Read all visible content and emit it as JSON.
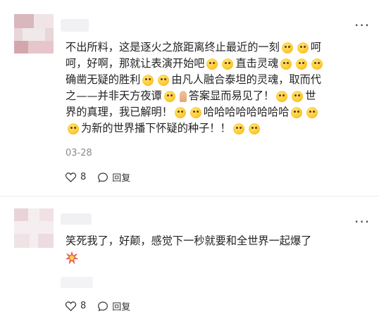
{
  "comments": [
    {
      "body_lines": [
        [
          {
            "t": "不出所料，这是逐火之旅距离终止最近的一刻"
          },
          {
            "e": "face-icon"
          },
          {
            "e": "face-icon"
          },
          {
            "t": "呵"
          }
        ],
        [
          {
            "t": "呵，好啊，那就让表演开始吧"
          },
          {
            "e": "face-icon"
          },
          {
            "e": "face-icon"
          },
          {
            "t": "直击灵魂"
          },
          {
            "e": "face-icon"
          },
          {
            "e": "face-icon"
          },
          {
            "e": "face-icon"
          }
        ],
        [
          {
            "t": "确凿无疑的胜利"
          },
          {
            "e": "face-icon"
          },
          {
            "e": "face-icon"
          },
          {
            "t": "由凡人融合泰坦的灵魂，取而代"
          }
        ],
        [
          {
            "t": "之——并非天方夜谭"
          },
          {
            "e": "face-icon"
          },
          {
            "e": "pray-icon"
          },
          {
            "t": "答案显而易见了！"
          },
          {
            "e": "face-icon"
          },
          {
            "e": "face-icon"
          },
          {
            "t": "世"
          }
        ],
        [
          {
            "t": "界的真理，我已解明！"
          },
          {
            "e": "face-icon"
          },
          {
            "e": "face-icon"
          },
          {
            "t": "哈哈哈哈哈哈哈哈"
          },
          {
            "e": "face-icon"
          },
          {
            "e": "face-icon"
          }
        ],
        [
          {
            "e": "face-icon"
          },
          {
            "t": "为新的世界播下怀疑的种子！！"
          },
          {
            "e": "face-icon"
          },
          {
            "e": "face-icon"
          }
        ]
      ],
      "date": "03-28",
      "likes": "8",
      "reply_label": "回复"
    },
    {
      "body_lines": [
        [
          {
            "t": "笑死我了，好颠，感觉下一秒就要和全世界一起爆了"
          }
        ],
        [
          {
            "e": "explosion-icon"
          }
        ]
      ],
      "likes": "8",
      "reply_label": "回复"
    }
  ],
  "icons": {
    "more": "more-dots-icon",
    "like": "heart-icon",
    "reply": "speech-bubble-icon"
  },
  "colors": {
    "text": "#222222",
    "muted": "#8a8a8a",
    "divider": "#ececec"
  }
}
